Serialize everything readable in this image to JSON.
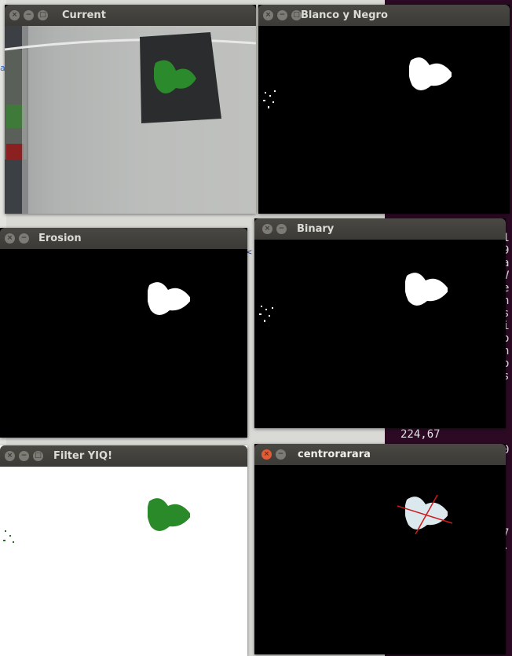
{
  "windows": {
    "current": {
      "title": "Current"
    },
    "blanco": {
      "title": "Blanco y Negro"
    },
    "erosion": {
      "title": "Erosion"
    },
    "binary": {
      "title": "Binary"
    },
    "filter": {
      "title": "Filter YIQ!"
    },
    "centro": {
      "title": "centrorarara"
    }
  },
  "terminal": {
    "coord": "224,67",
    "chars_top": [
      "7",
      "0"
    ],
    "chars_mid": [
      "1",
      "9",
      "a",
      "V",
      "e",
      "n",
      "s",
      "i",
      "o",
      "n",
      "o",
      "s"
    ],
    "chars_bottom": [
      "0",
      "7",
      "."
    ]
  },
  "stray": {
    "left": "a",
    "mid": "<"
  },
  "colors": {
    "heart_green": "#2a8a2a",
    "heart_white": "#ffffff",
    "crosshair": "#cc1b1b",
    "centro_heart": "#dbe9ee"
  }
}
